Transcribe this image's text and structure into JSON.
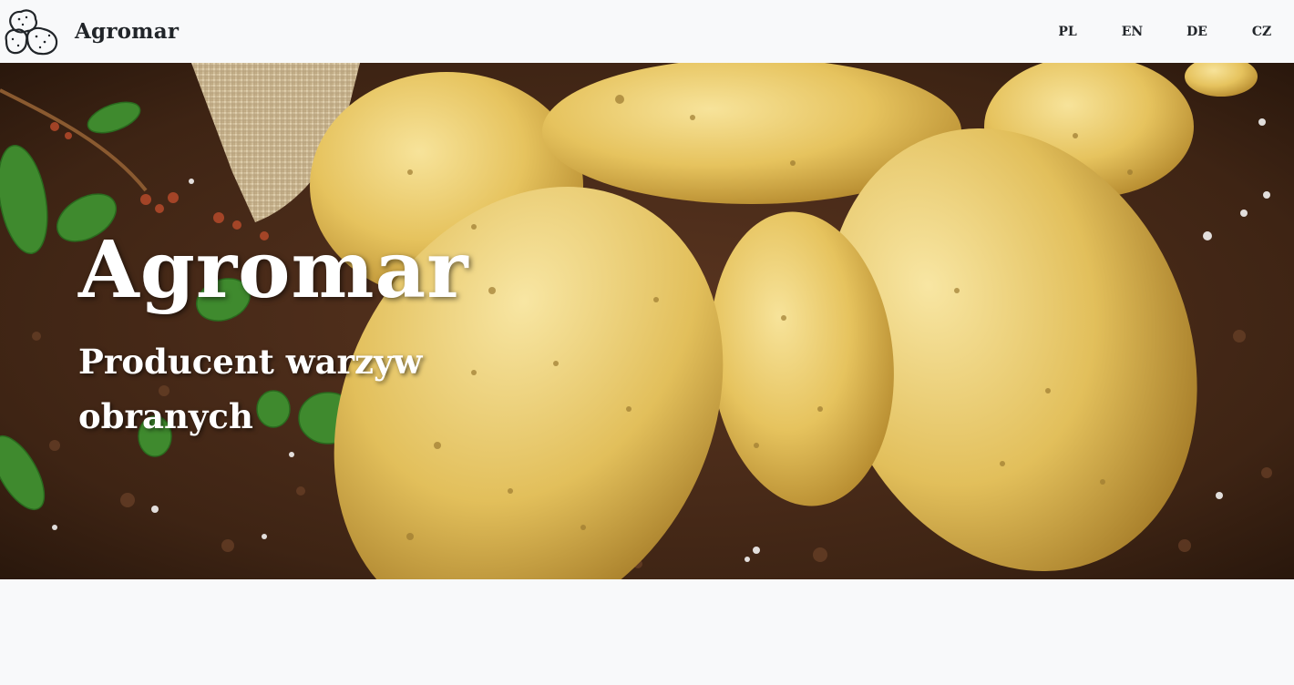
{
  "navbar": {
    "brand": {
      "name": "Agromar",
      "logo_icon": "potatoes-outline-icon"
    },
    "languages": [
      "PL",
      "EN",
      "DE",
      "CZ"
    ]
  },
  "hero": {
    "image": "potatoes-on-soil-photo",
    "title": "Agromar",
    "subtitle": "Producent warzyw obranych"
  },
  "colors": {
    "navbar_bg": "#f8f9fa",
    "text_dark": "#212529",
    "hero_text": "#ffffff",
    "potato": "#e8c25a",
    "soil": "#4a2c18"
  }
}
